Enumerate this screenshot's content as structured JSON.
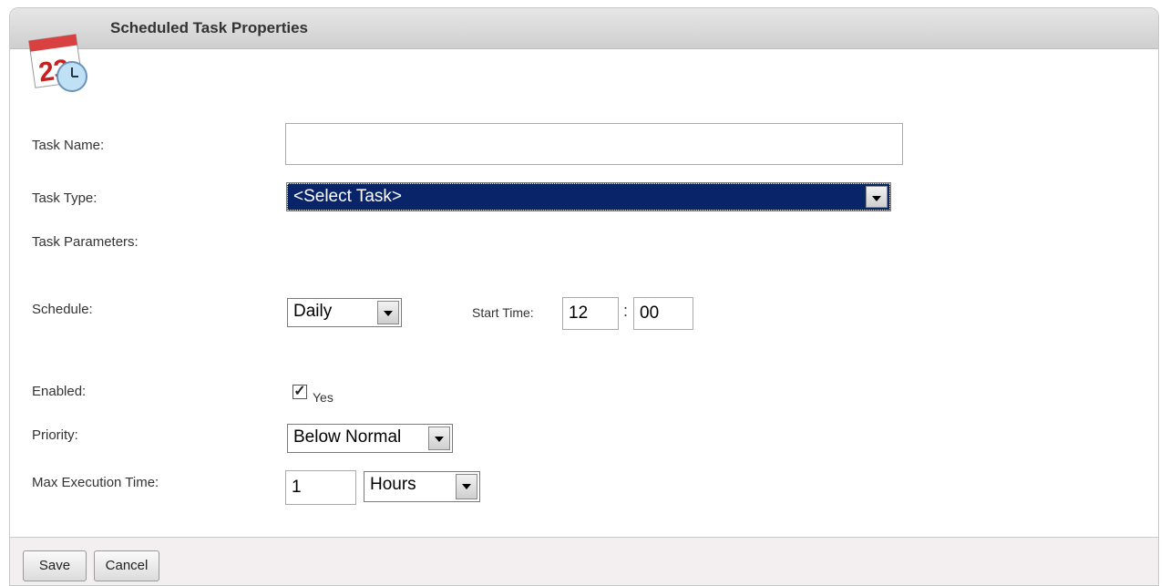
{
  "header": {
    "title": "Scheduled Task Properties",
    "icon": "calendar-clock-icon",
    "calendar_number": "23"
  },
  "form": {
    "task_name": {
      "label": "Task Name:",
      "value": ""
    },
    "task_type": {
      "label": "Task Type:",
      "selected": "<Select Task>"
    },
    "task_parameters": {
      "label": "Task Parameters:"
    },
    "schedule": {
      "label": "Schedule:",
      "selected": "Daily",
      "start_time_label": "Start Time:",
      "hour": "12",
      "separator": ":",
      "minute": "00"
    },
    "enabled": {
      "label": "Enabled:",
      "checked": true,
      "option_label": "Yes",
      "check_glyph": "✓"
    },
    "priority": {
      "label": "Priority:",
      "selected": "Below Normal"
    },
    "max_execution_time": {
      "label": "Max Execution Time:",
      "value": "1",
      "unit": "Hours"
    }
  },
  "footer": {
    "save_label": "Save",
    "cancel_label": "Cancel"
  },
  "colors": {
    "title_bar": "#d6d6d6",
    "task_type_highlight": "#0a246a",
    "footer_bg": "#f3eef0"
  }
}
